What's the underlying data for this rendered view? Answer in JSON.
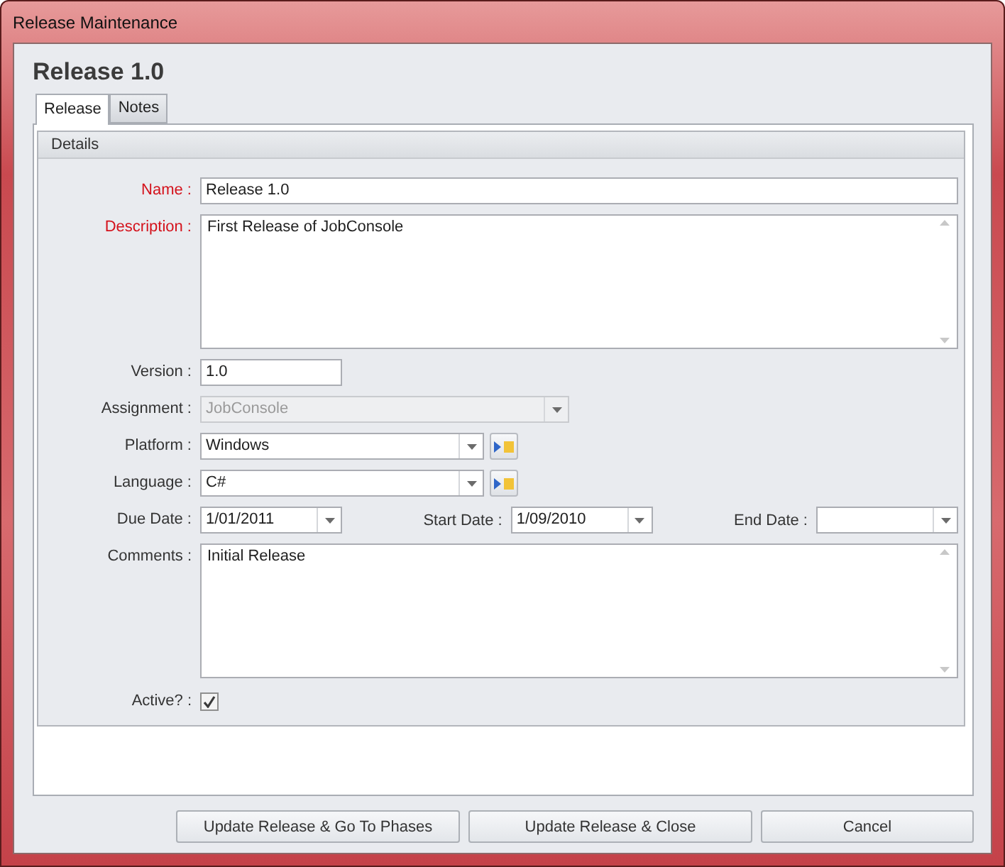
{
  "window": {
    "title": "Release Maintenance"
  },
  "heading": "Release 1.0",
  "tabs": [
    {
      "label": "Release",
      "selected": true
    },
    {
      "label": "Notes",
      "selected": false
    }
  ],
  "group": {
    "title": "Details"
  },
  "name": {
    "label": "Name :",
    "required": true,
    "value": "Release 1.0"
  },
  "description": {
    "label": "Description :",
    "required": true,
    "value": "First Release of JobConsole"
  },
  "version": {
    "label": "Version :",
    "required": false,
    "value": "1.0"
  },
  "assignment": {
    "label": "Assignment :",
    "required": false,
    "value": "JobConsole",
    "disabled": true
  },
  "platform": {
    "label": "Platform :",
    "required": false,
    "value": "Windows",
    "disabled": false
  },
  "language": {
    "label": "Language :",
    "required": false,
    "value": "C#",
    "disabled": false
  },
  "dates": [
    {
      "label": "Due Date :",
      "value": "1/01/2011"
    },
    {
      "label": "Start Date :",
      "value": "1/09/2010"
    },
    {
      "label": "End Date :"
    }
  ],
  "comments": {
    "label": "Comments :",
    "required": false,
    "value": "Initial Release"
  },
  "active": {
    "label": "Active? :",
    "checked": true
  },
  "buttons": [
    "Update Release & Go To Phases",
    "Update Release & Close",
    "Cancel"
  ]
}
